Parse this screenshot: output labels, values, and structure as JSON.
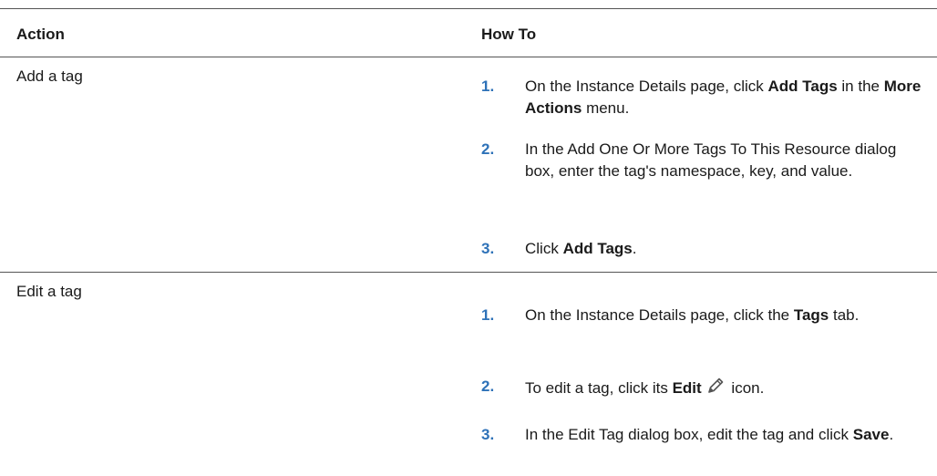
{
  "table": {
    "headers": {
      "action": "Action",
      "how_to": "How To"
    },
    "rows": [
      {
        "action": "Add a tag",
        "steps": [
          {
            "num": "1.",
            "parts": [
              "On the Instance Details page, click ",
              "Add Tags",
              " in the ",
              "More Actions",
              " menu."
            ]
          },
          {
            "num": "2.",
            "text": "In the Add One Or More Tags To This Resource dialog box, enter the tag's namespace, key, and value."
          },
          {
            "num": "3.",
            "parts": [
              "Click ",
              "Add Tags",
              "."
            ]
          }
        ]
      },
      {
        "action": "Edit a tag",
        "steps": [
          {
            "num": "1.",
            "parts": [
              "On the Instance Details page, click the ",
              "Tags",
              " tab."
            ]
          },
          {
            "num": "2.",
            "parts": [
              "To edit a tag, click its ",
              "Edit",
              " icon."
            ],
            "icon": "pencil-icon"
          },
          {
            "num": "3.",
            "parts": [
              "In the Edit Tag dialog box, edit the tag and click ",
              "Save",
              "."
            ]
          }
        ]
      }
    ]
  }
}
